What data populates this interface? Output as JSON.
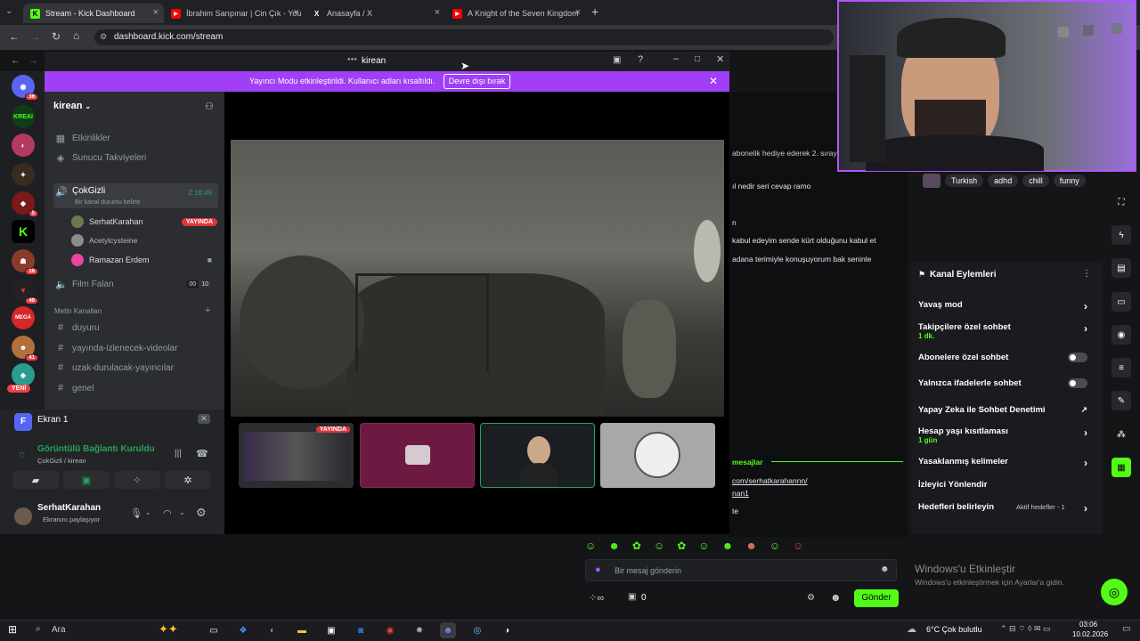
{
  "browser": {
    "tabs": [
      {
        "title": "Stream - Kick Dashboard",
        "icon": "K",
        "color": "#53fc18",
        "active": true
      },
      {
        "title": "İbrahim Sarıpınar | Cin Çık - You",
        "icon": "▶",
        "color": "#ff0000"
      },
      {
        "title": "Anasayfa / X",
        "icon": "X",
        "color": "#000000"
      },
      {
        "title": "A Knight of the Seven Kingdom",
        "icon": "▶",
        "color": "#ff0000"
      }
    ],
    "url": "dashboard.kick.com/stream"
  },
  "discord": {
    "window_title": "kirean",
    "banner_text": "Yayıncı Modu etkinleştirildi. Kullanıcı adları kısaltıldı.",
    "banner_button": "Devre dışı bırak",
    "server_name": "kirean",
    "top_items": [
      "Etkinlikler",
      "Sunucu Takviyeleri"
    ],
    "voice_channel": {
      "name": "ÇokGizli",
      "time": "2:16:49",
      "status": "Bir kanal durumu belirle"
    },
    "voice_users": [
      {
        "name": "SerhatKarahan",
        "badge": "YAYINDA"
      },
      {
        "name": "Acetylcysteine"
      },
      {
        "name": "Ramazan Erdem"
      }
    ],
    "film_channel": {
      "name": "Film Falan",
      "count": "00",
      "limit": "10"
    },
    "text_category": "Metin Kanalları",
    "text_channels": [
      "duyuru",
      "yayında-izlenecek-videolar",
      "uzak-durulacak-yayıncılar",
      "genel"
    ],
    "screen_share": "Ekran 1",
    "connection": {
      "status": "Görüntülü Bağlantı Kuruldu",
      "location": "ÇokGizli / kirean"
    },
    "self": {
      "name": "SerhatKarahan",
      "status": "Ekranını paylaşıyor"
    },
    "tile_badge": "YAYINDA"
  },
  "servers": [
    {
      "badge": "36"
    },
    {
      "badge": ""
    },
    {
      "badge": ""
    },
    {
      "badge": ""
    },
    {
      "badge": "5"
    },
    {
      "badge": ""
    },
    {
      "badge": "16"
    },
    {
      "badge": "49"
    },
    {
      "badge": ""
    },
    {
      "badge": "41"
    },
    {
      "badge": "YENİ"
    }
  ],
  "chat": {
    "lines": [
      "abonelik hediye ederek 2. sıraya y",
      "ıl nedir seri cevap ramo",
      "n",
      "kabul edeyim sende kürt olduğunu kabul et",
      "adana terimiyle konuşuyorum bak seninle",
      "mesajlar",
      "com/serhatkarahannn/",
      "nan1",
      "te"
    ],
    "tags": [
      "Turkish",
      "adhd",
      "chill",
      "funny"
    ],
    "input_placeholder": "Bir mesaj gönderin",
    "send_button": "Gönder",
    "count": "0"
  },
  "channel_actions": {
    "title": "Kanal Eylemleri",
    "items": [
      {
        "label": "Yavaş mod",
        "control": "chevron"
      },
      {
        "label": "Takipçilere özel sohbet",
        "sub": "1 dk.",
        "control": "chevron"
      },
      {
        "label": "Abonelere özel sohbet",
        "control": "toggle"
      },
      {
        "label": "Yalnızca ifadelerle sohbet",
        "control": "toggle"
      },
      {
        "label": "Yapay Zeka ile Sohbet Denetimi",
        "control": "external"
      },
      {
        "label": "Hesap yaşı kısıtlaması",
        "sub": "1 gün",
        "control": "chevron"
      },
      {
        "label": "Yasaklanmış kelimeler",
        "control": "chevron"
      },
      {
        "label": "İzleyici Yönlendir",
        "control": "none"
      },
      {
        "label": "Hedefleri belirleyin",
        "control": "chevron",
        "extra": "Aktif hedefler - 1"
      }
    ]
  },
  "windows": {
    "activate_title": "Windows'u Etkinleştir",
    "activate_sub": "Windows'u etkinleştirmek için Ayarlar'a gidin.",
    "search": "Ara",
    "weather": "6°C  Çok bulutlu",
    "time": "03:06",
    "date": "10.02.2026"
  }
}
